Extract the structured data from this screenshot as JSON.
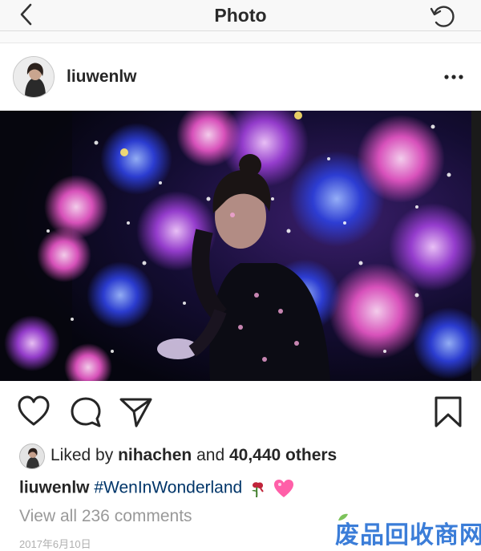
{
  "nav": {
    "title": "Photo"
  },
  "post": {
    "username": "liuwenlw",
    "likes": {
      "prefix": "Liked by",
      "user": "nihachen",
      "middle": "and",
      "count": "40,440 others"
    },
    "caption": {
      "user": "liuwenlw",
      "hashtag": "#WenInWonderland"
    },
    "comments_link": "View all 236 comments",
    "date": "2017年6月10日"
  },
  "watermark": "废品回收商网",
  "colors": {
    "hashtag": "#003569",
    "watermark": "#3b7dd8",
    "heart_emoji": "#ff5fa8",
    "rose": "#c0243a"
  },
  "icons": [
    "back-chevron-icon",
    "refresh-icon",
    "more-icon",
    "heart-icon",
    "comment-icon",
    "share-icon",
    "bookmark-icon"
  ]
}
